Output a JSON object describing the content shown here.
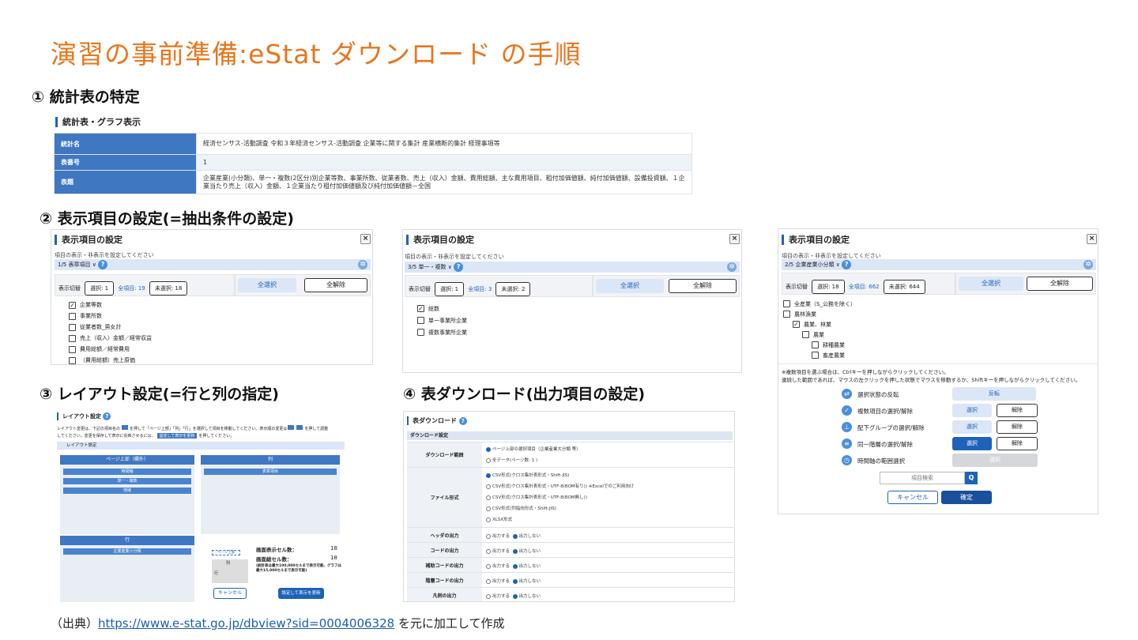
{
  "title": "演習の事前準備:eStat ダウンロード の手順",
  "section1": "① 統計表の特定",
  "section2": "② 表示項目の設定(=抽出条件の設定)",
  "section3": "③ レイアウト設定(=行と列の指定)",
  "section4": "④ 表ダウンロード(出力項目の設定)",
  "table_section": {
    "heading": "統計表・グラフ表示",
    "rows": [
      {
        "key": "統計名",
        "value": "経済センサス-活動調査 令和３年経済センサス-活動調査 企業等に関する集計 産業横断的集計 経理事項等"
      },
      {
        "key": "表番号",
        "value": "1"
      },
      {
        "key": "表題",
        "value": "企業産業(小分類)、単一・複数(2区分)別企業等数、事業所数、従業者数、売上（収入）金額、費用総額、主な費用項目、粗付加価値額、純付加価値額、設備投資額、１企業当たり売上（収入）金額、１企業当たり粗付加価値額及び純付加価値額－全国"
      }
    ]
  },
  "panel_a": {
    "heading": "表示項目の設定",
    "close": "×",
    "note": "項目の表示・非表示を設定してください",
    "select": "1/5 表章項目",
    "toggle_label": "表示切替",
    "selected": "選択: 1",
    "all": "全項目: 19",
    "unselected": "未選択: 18",
    "select_all": "全選択",
    "deselect_all": "全解除",
    "items": [
      {
        "label": "企業等数",
        "checked": true
      },
      {
        "label": "事業所数",
        "checked": false
      },
      {
        "label": "従業者数_男女計",
        "checked": false
      },
      {
        "label": "売上（収入）金額／経常収益",
        "checked": false
      },
      {
        "label": "費用総額／経常費用",
        "checked": false
      },
      {
        "label": "（費用総額）売上原価",
        "checked": false
      }
    ]
  },
  "panel_b": {
    "heading": "表示項目の設定",
    "close": "×",
    "note": "項目の表示・非表示を設定してください",
    "select": "3/5 単一・複数",
    "toggle_label": "表示切替",
    "selected": "選択: 1",
    "all": "全項目: 3",
    "unselected": "未選択: 2",
    "select_all": "全選択",
    "deselect_all": "全解除",
    "items": [
      {
        "label": "総数",
        "checked": true
      },
      {
        "label": "単一事業所企業",
        "checked": false
      },
      {
        "label": "複数事業所企業",
        "checked": false
      }
    ]
  },
  "panel_c": {
    "heading": "表示項目の設定",
    "close": "×",
    "note": "項目の表示・非表示を設定してください",
    "select": "2/5 企業産業小分類",
    "toggle_label": "表示切替",
    "selected": "選択: 18",
    "all": "全項目: 662",
    "unselected": "未選択: 644",
    "select_all": "全選択",
    "deselect_all": "全解除",
    "items": [
      {
        "label": "全産業（S_公務を除く）",
        "checked": false,
        "indent": 0
      },
      {
        "label": "農林漁業",
        "checked": false,
        "indent": 0
      },
      {
        "label": "農業、林業",
        "checked": true,
        "indent": 1
      },
      {
        "label": "農業",
        "checked": false,
        "indent": 2
      },
      {
        "label": "耕種農業",
        "checked": false,
        "indent": 3
      },
      {
        "label": "畜産農業",
        "checked": false,
        "indent": 3
      }
    ],
    "help1": "※複数項目を選ぶ場合は、Ctrlキーを押しながらクリックしてください。",
    "help2": "連続した範囲であれば、マウスの左クリックを押した状態でマウスを移動するか、Shiftキーを押しながらクリックしてください。",
    "op_reverse": "選択状態の反転",
    "op_reverse_btn": "反転",
    "op_multi": "複数項目の選択/解除",
    "op_group": "配下グループの選択/解除",
    "op_level": "同一階層の選択/解除",
    "op_time": "時間軸の範囲選択",
    "op_time_btn": "選択",
    "select_btn": "選択",
    "release_btn": "解除",
    "search_placeholder": "項目検索",
    "search_btn": "Q",
    "cancel": "キャンセル",
    "confirm": "確定"
  },
  "layout_panel": {
    "heading": "レイアウト設定",
    "desc1": "レイアウト変更は、下記の項目名の",
    "desc2": "を押して「ページ上部」「列」「行」を選択して項目を移動してください。表示順の変更は",
    "desc3": "を押して調整",
    "desc4": "してください。変更を保存して表示に反映させるには、",
    "desc_btn": "設定して表示を更新",
    "desc5": "を押してください。",
    "subheading": "レイアウト設定",
    "page_top_header": "ページ上部（欄外）",
    "page_top_items": [
      "時間軸",
      "単一・複数",
      "地域"
    ],
    "col_header": "列",
    "col_items": [
      "表章項目"
    ],
    "row_header": "行",
    "row_items": [
      "企業産業小分類"
    ],
    "mini_page": "ページ上部",
    "mini_col": "列",
    "mini_row": "行",
    "cells_label": "画面表示セル数：",
    "cells_value": "18",
    "total_label": "画面総セル数：",
    "total_value": "18",
    "limit_note": "(統計表は最大100,000セルまで表示可能、グラフは最大15,000セルまで表示可能)",
    "cancel": "キャンセル",
    "apply": "設定して表示を更新"
  },
  "download_panel": {
    "heading": "表ダウンロード",
    "subheading": "ダウンロード設定",
    "range_label": "ダウンロード範囲",
    "range_opts": [
      "ページ上部の選択項目（企業産業大分類 等）",
      "全データ(ページ数: 1 )"
    ],
    "format_label": "ファイル形式",
    "format_opts": [
      "CSV形式(クロス集計表形式・Shift-JIS)",
      "CSV形式(クロス集計表形式・UTF-8(BOM有り)) ※Excelでのご利用向け",
      "CSV形式(クロス集計表形式・UTF-8(BOM無し))",
      "CSV形式(列指向形式・Shift-JIS)",
      "XLSX形式"
    ],
    "header_label": "ヘッダの出力",
    "code_label": "コードの出力",
    "aux_label": "補助コードの出力",
    "level_label": "階層コードの出力",
    "legend_label": "凡例の出力",
    "output_yes": "出力する",
    "output_no": "出力しない"
  },
  "source": {
    "prefix": "（出典）",
    "link": "https://www.e-stat.go.jp/dbview?sid=0004006328",
    "suffix": " を元に加工して作成"
  },
  "colors": {
    "title": "#e8761c",
    "accent": "#1f63b8",
    "header_blue": "#3f77c2"
  }
}
